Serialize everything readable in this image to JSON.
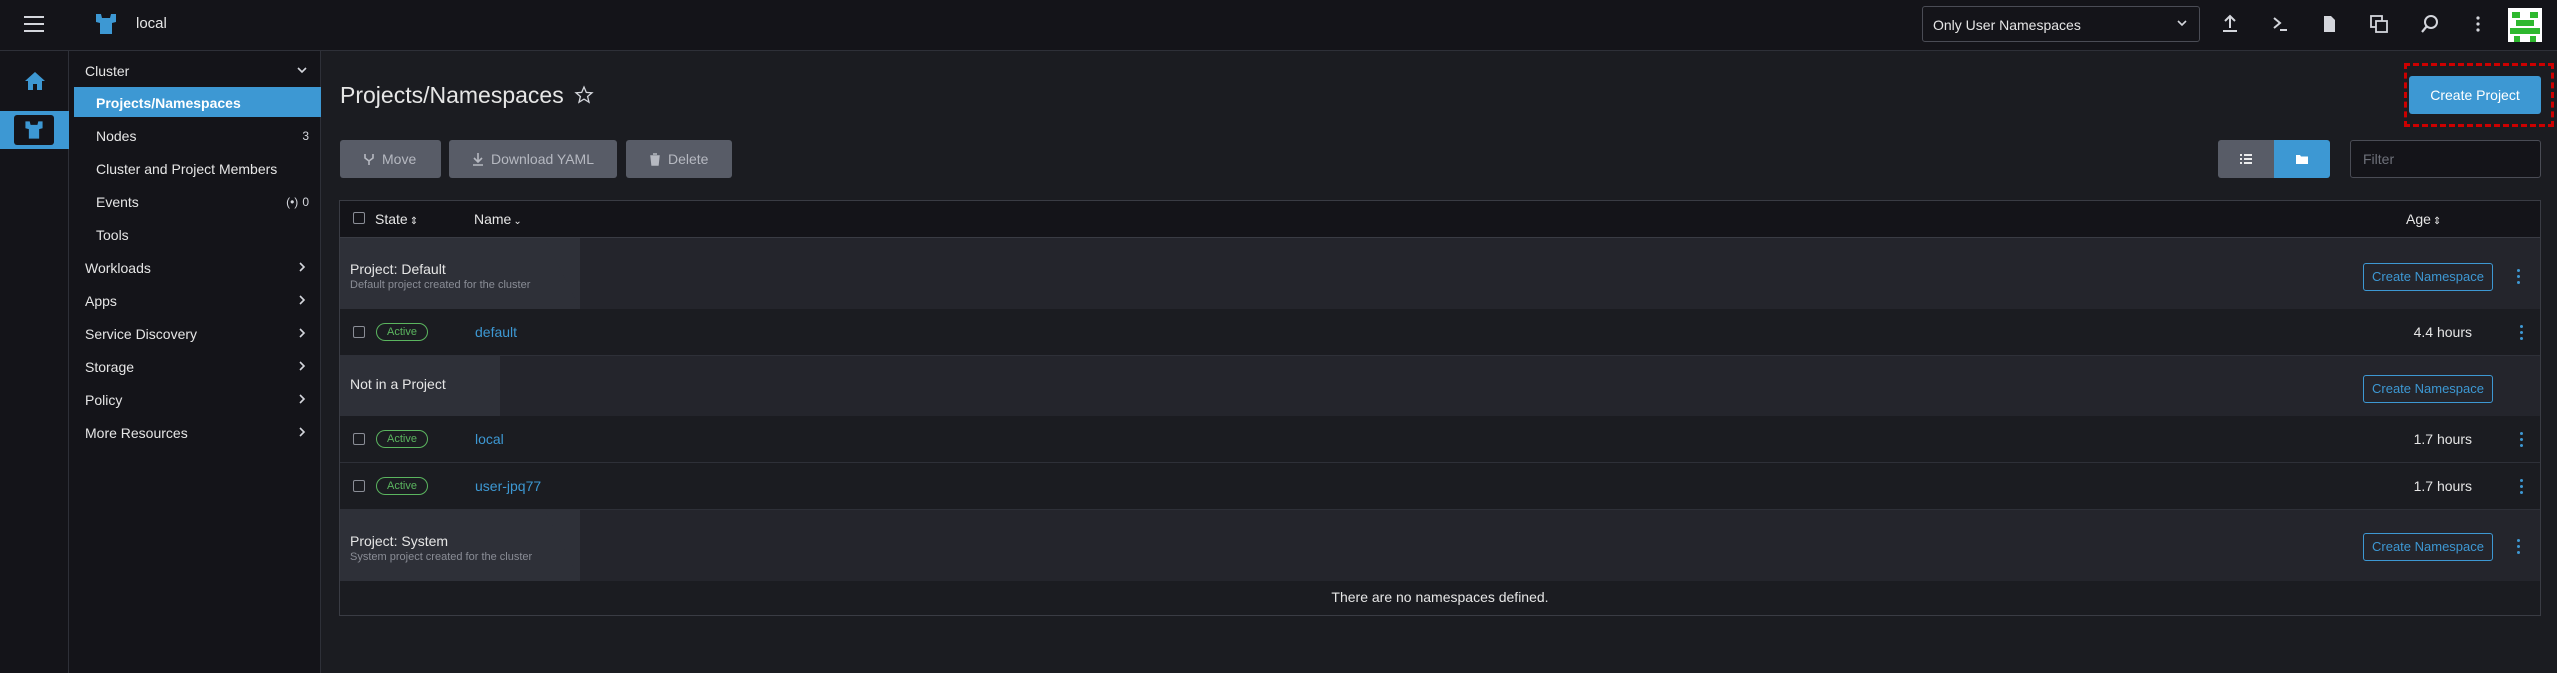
{
  "header": {
    "cluster_name": "local",
    "namespace_filter": "Only User Namespaces",
    "icons": [
      "hamburger-icon",
      "cluster-logo-icon",
      "upload-icon",
      "terminal-icon",
      "file-icon",
      "copy-icon",
      "search-icon",
      "more-vertical-icon",
      "avatar-icon"
    ]
  },
  "sidebar": {
    "groups": [
      {
        "label": "Cluster",
        "expanded": true
      },
      {
        "label": "Workloads"
      },
      {
        "label": "Apps"
      },
      {
        "label": "Service Discovery"
      },
      {
        "label": "Storage"
      },
      {
        "label": "Policy"
      },
      {
        "label": "More Resources"
      }
    ],
    "cluster_items": [
      {
        "label": "Projects/Namespaces",
        "active": true,
        "count": ""
      },
      {
        "label": "Nodes",
        "count": "3"
      },
      {
        "label": "Cluster and Project Members",
        "count": ""
      },
      {
        "label": "Events",
        "count": "0"
      },
      {
        "label": "Tools",
        "count": ""
      }
    ]
  },
  "main": {
    "title": "Projects/Namespaces",
    "create_project_label": "Create Project",
    "actions": {
      "move": "Move",
      "download_yaml": "Download YAML",
      "delete": "Delete"
    },
    "filter_placeholder": "Filter",
    "columns": {
      "state": "State",
      "name": "Name",
      "age": "Age"
    },
    "groups": [
      {
        "title": "Project:  Default",
        "subtitle": "Default project created for the cluster",
        "action": "Create Namespace",
        "rows": [
          {
            "state": "Active",
            "name": "default",
            "age": "4.4 hours"
          }
        ]
      },
      {
        "title": "Not in a Project",
        "subtitle": "",
        "action": "Create Namespace",
        "rows": [
          {
            "state": "Active",
            "name": "local",
            "age": "1.7 hours"
          },
          {
            "state": "Active",
            "name": "user-jpq77",
            "age": "1.7 hours"
          }
        ]
      },
      {
        "title": "Project:  System",
        "subtitle": "System project created for the cluster",
        "action": "Create Namespace",
        "rows": []
      }
    ],
    "empty_message": "There are no namespaces defined."
  },
  "colors": {
    "accent": "#3d98d3",
    "active_badge": "#5bb55f",
    "background": "#1b1c21",
    "panel": "#141419"
  }
}
